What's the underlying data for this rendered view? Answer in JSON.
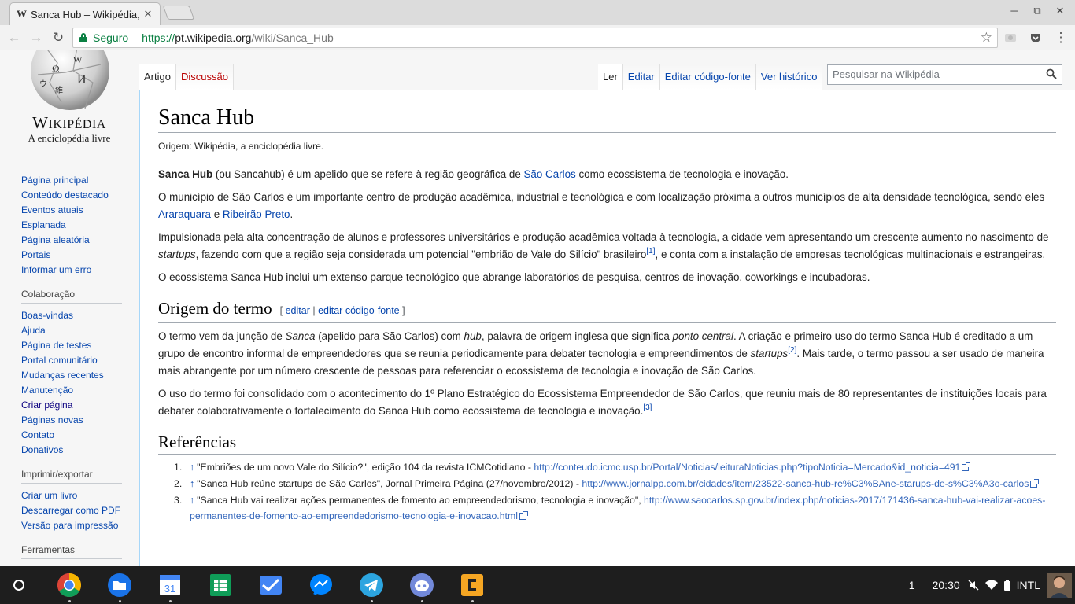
{
  "browser": {
    "tab_title": "Sanca Hub – Wikipédia, a enciclopédia livre",
    "tab_favicon": "W",
    "close_glyph": "✕",
    "secure_label": "Seguro",
    "url_scheme": "https://",
    "url_host": "pt.wikipedia.org",
    "url_path": "/wiki/Sanca_Hub",
    "window_minimize": "─",
    "window_restore": "⧉",
    "window_close": "✕",
    "back_glyph": "←",
    "forward_glyph": "→",
    "reload_glyph": "↻",
    "star_glyph": "☆",
    "menu_glyph": "⋮"
  },
  "wiki": {
    "wordmark_w": "W",
    "wordmark_rest": "IKIPÉDIA",
    "tagline": "A enciclopédia livre",
    "nav_links": [
      "Página principal",
      "Conteúdo destacado",
      "Eventos atuais",
      "Esplanada",
      "Página aleatória",
      "Portais",
      "Informar um erro"
    ],
    "colab_heading": "Colaboração",
    "colab_links": [
      "Boas-vindas",
      "Ajuda",
      "Página de testes",
      "Portal comunitário",
      "Mudanças recentes",
      "Manutenção",
      "Criar página",
      "Páginas novas",
      "Contato",
      "Donativos"
    ],
    "print_heading": "Imprimir/exportar",
    "print_links": [
      "Criar um livro",
      "Descarregar como PDF",
      "Versão para impressão"
    ],
    "tools_heading": "Ferramentas",
    "tab_article": "Artigo",
    "tab_discussion": "Discussão",
    "tab_read": "Ler",
    "tab_edit": "Editar",
    "tab_edit_source": "Editar código-fonte",
    "tab_history": "Ver histórico",
    "search_placeholder": "Pesquisar na Wikipédia"
  },
  "article": {
    "title": "Sanca Hub",
    "site_sub": "Origem: Wikipédia, a enciclopédia livre.",
    "p1_bold": "Sanca Hub",
    "p1_a": " (ou Sancahub) é um apelido que se refere à região geográfica de ",
    "p1_link": "São Carlos",
    "p1_b": " como ecossistema de tecnologia e inovação.",
    "p2_a": "O município de São Carlos é um importante centro de produção acadêmica, industrial e tecnológica e com localização próxima a outros municípios de alta densidade tecnológica, sendo eles ",
    "p2_link1": "Araraquara",
    "p2_mid": " e ",
    "p2_link2": "Ribeirão Preto",
    "p2_end": ".",
    "p3_a": "Impulsionada pela alta concentração de alunos e professores universitários e produção acadêmica voltada à tecnologia, a cidade vem apresentando um crescente aumento no nascimento de ",
    "p3_em": "startups",
    "p3_b": ", fazendo com que a região seja considerada um potencial \"embrião de Vale do Silício\" brasileiro",
    "p3_ref": "[1]",
    "p3_c": ", e conta com a instalação de empresas tecnológicas multinacionais e estrangeiras.",
    "p4": "O ecossistema Sanca Hub inclui um extenso parque tecnológico que abrange laboratórios de pesquisa, centros de inovação, coworkings e incubadoras.",
    "h2_origin": "Origem do termo",
    "edit_open": "[ ",
    "edit_link": "editar",
    "edit_sep": " | ",
    "edit_source_link": "editar código-fonte",
    "edit_close": " ]",
    "p5_a": "O termo vem da junção de ",
    "p5_em1": "Sanca",
    "p5_b": " (apelido para São Carlos) com ",
    "p5_em2": "hub",
    "p5_c": ", palavra de origem inglesa que significa ",
    "p5_em3": "ponto central",
    "p5_d": ". A criação e primeiro uso do termo Sanca Hub é creditado a um grupo de encontro informal de empreendedores que se reunia periodicamente para debater tecnologia e empreendimentos de ",
    "p5_em4": "startups",
    "p5_ref": "[2]",
    "p5_e": ". Mais tarde, o termo passou a ser usado de maneira mais abrangente por um número crescente de pessoas para referenciar o ecossistema de tecnologia e inovação de São Carlos.",
    "p6_a": "O uso do termo foi consolidado com o acontecimento do 1º Plano Estratégico do Ecossistema Empreendedor de São Carlos, que reuniu mais de 80 representantes de instituições locais para debater colaborativamente o fortalecimento do Sanca Hub como ecossistema de tecnologia e inovação.",
    "p6_ref": "[3]",
    "h2_refs": "Referências",
    "up_arrow": "↑",
    "refs": [
      {
        "num": "1.",
        "text": "\"Embriões de um novo Vale do Silício?\", edição 104 da revista ICMCotidiano - ",
        "url": "http://conteudo.icmc.usp.br/Portal/Noticias/leituraNoticias.php?tipoNoticia=Mercado&id_noticia=491"
      },
      {
        "num": "2.",
        "text": "\"Sanca Hub reúne startups de São Carlos\", Jornal Primeira Página (27/novembro/2012) - ",
        "url": "http://www.jornalpp.com.br/cidades/item/23522-sanca-hub-re%C3%BAne-starups-de-s%C3%A3o-carlos"
      },
      {
        "num": "3.",
        "text": "\"Sanca Hub vai realizar ações permanentes de fomento ao empreendedorismo, tecnologia e inovação\", ",
        "url": "http://www.saocarlos.sp.gov.br/index.php/noticias-2017/171436-sanca-hub-vai-realizar-acoes-permanentes-de-fomento-ao-empreendedorismo-tecnologia-e-inovacao.html"
      }
    ]
  },
  "shelf": {
    "apps": [
      "chrome-icon",
      "files-icon",
      "calendar-icon",
      "sheets-icon",
      "inbox-icon",
      "messenger-icon",
      "telegram-icon",
      "discord-icon",
      "cimbalino-icon"
    ],
    "calendar_day": "31",
    "notification_count": "1",
    "time": "20:30",
    "input_method": "INTL"
  }
}
